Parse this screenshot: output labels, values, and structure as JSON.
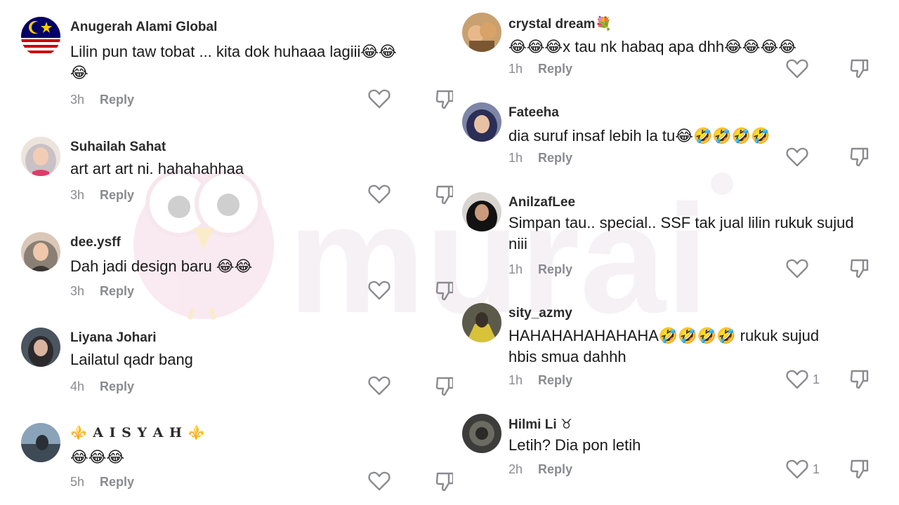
{
  "left_comments": [
    {
      "username": "Anugerah Alami Global",
      "text_line1": "Lilin pun taw tobat ... kita dok huhaaa lagiii😂😂",
      "text_line2": "😂",
      "time": "3h",
      "reply": "Reply"
    },
    {
      "username": "Suhailah Sahat",
      "text_line1": "art art art ni. hahahahhaa",
      "time": "3h",
      "reply": "Reply"
    },
    {
      "username": "dee.ysff",
      "text_line1": "Dah jadi design baru 😂😂",
      "time": "3h",
      "reply": "Reply"
    },
    {
      "username": "Liyana Johari",
      "text_line1": "Lailatul qadr bang",
      "time": "4h",
      "reply": "Reply"
    },
    {
      "username": "⚜️ A I S Y A H ⚜️",
      "text_line1": "😂😂😂",
      "time": "5h",
      "reply": "Reply"
    }
  ],
  "right_comments": [
    {
      "username": "crystal dream💐",
      "text_line1": "😂😂😂x tau nk habaq apa dhh😂😂😂😂",
      "time": "1h",
      "reply": "Reply"
    },
    {
      "username": "Fateeha",
      "text_line1": "dia suruf insaf lebih la tu😂🤣🤣🤣🤣",
      "time": "1h",
      "reply": "Reply"
    },
    {
      "username": "AnilzafLee",
      "text_line1": "Simpan tau.. special.. SSF tak jual lilin rukuk sujud",
      "text_line2": "niii",
      "time": "1h",
      "reply": "Reply"
    },
    {
      "username": "sity_azmy",
      "text_line1": "HAHAHAHAHAHAHA🤣🤣🤣🤣 rukuk sujud",
      "text_line2": "hbis smua dahhh",
      "time": "1h",
      "reply": "Reply",
      "likes": "1"
    },
    {
      "username": "Hilmi Li ♉",
      "text_line1": "Letih? Dia pon letih",
      "time": "2h",
      "reply": "Reply",
      "likes": "1"
    }
  ],
  "watermark": {
    "brand": "murai"
  },
  "colors": {
    "text": "#1a1a1a",
    "meta": "#8a8b91",
    "watermark": "#e9dde4"
  }
}
